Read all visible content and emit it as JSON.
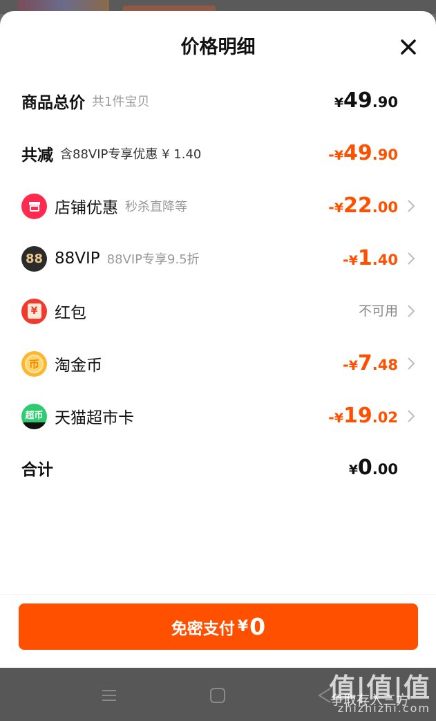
{
  "sheet": {
    "title": "价格明细"
  },
  "rows": {
    "total_price": {
      "label": "商品总价",
      "sub": "共1件宝贝",
      "currency": "¥",
      "int": "49",
      "dec": ".90"
    },
    "total_discount": {
      "label": "共减",
      "sub": "含88VIP专享优惠 ¥ 1.40",
      "prefix": "-",
      "currency": "¥",
      "int": "49",
      "dec": ".90"
    },
    "shop_discount": {
      "label": "店铺优惠",
      "sub": "秒杀直降等",
      "prefix": "-",
      "currency": "¥",
      "int": "22",
      "dec": ".00",
      "icon": "shop-icon"
    },
    "vip88": {
      "label": "88VIP",
      "sub": "88VIP专享9.5折",
      "prefix": "-",
      "currency": "¥",
      "int": "1",
      "dec": ".40",
      "icon": "88vip-icon",
      "icon_text": "88"
    },
    "red_packet": {
      "label": "红包",
      "status": "不可用",
      "icon": "red-packet-icon",
      "icon_text": "¥"
    },
    "taojinbi": {
      "label": "淘金币",
      "prefix": "-",
      "currency": "¥",
      "int": "7",
      "dec": ".48",
      "icon": "coin-icon",
      "icon_text": "币"
    },
    "tmall_card": {
      "label": "天猫超市卡",
      "prefix": "-",
      "currency": "¥",
      "int": "19",
      "dec": ".02",
      "icon": "tmall-supermarket-icon",
      "icon_text": "超币"
    },
    "sum": {
      "label": "合计",
      "currency": "¥",
      "int": "0",
      "dec": ".00"
    }
  },
  "pay_button": {
    "label": "免密支付",
    "currency": "¥",
    "amount": "0"
  },
  "watermark": {
    "big": "值|值|值",
    "small": "zhizhizhi.com",
    "overlay": "争取存入三方"
  },
  "colors": {
    "accent": "#ff5000",
    "text": "#111111",
    "muted": "#999999",
    "shop_icon": "#ff2a4d",
    "vip_icon": "#2b2b2b",
    "red_packet_icon": "#f03a2e",
    "coin_icon": "#ffb62e",
    "tmall_icon": "#2ecc71"
  }
}
